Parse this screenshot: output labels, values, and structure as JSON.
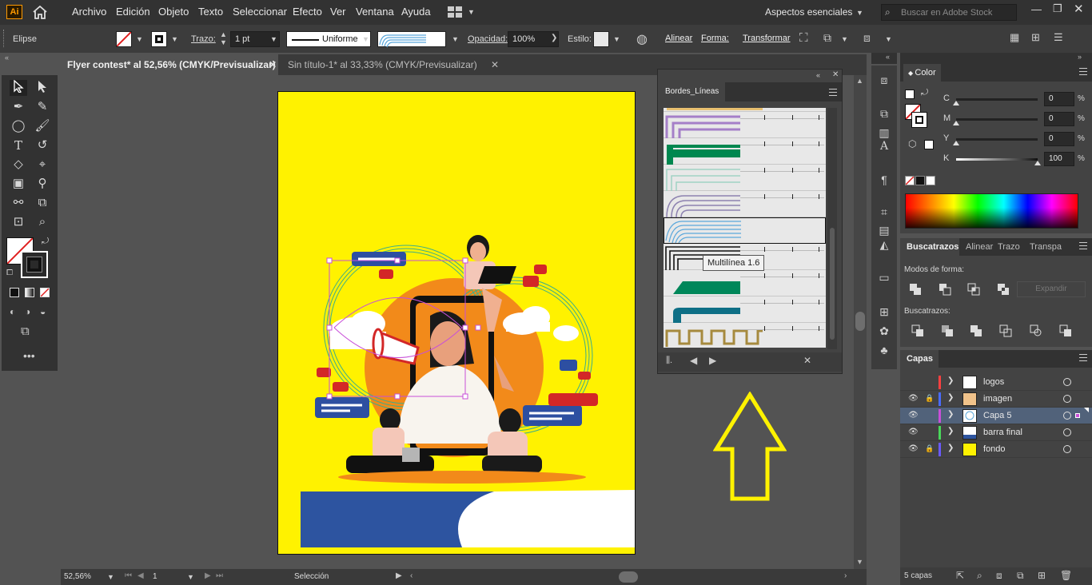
{
  "app": {
    "logo": "Ai",
    "accent": "#ff9a00"
  },
  "menubar": {
    "items": [
      "Archivo",
      "Edición",
      "Objeto",
      "Texto",
      "Seleccionar",
      "Efecto",
      "Ver",
      "Ventana",
      "Ayuda"
    ],
    "workspace": "Aspectos esenciales",
    "search_placeholder": "Buscar en Adobe Stock"
  },
  "controlbar": {
    "selection_type": "Elipse",
    "stroke_label": "Trazo:",
    "stroke_weight": "1 pt",
    "profile": "Uniforme",
    "opacity_label": "Opacidad:",
    "opacity": "100%",
    "style_label": "Estilo:",
    "align": "Alinear",
    "shape": "Forma:",
    "transform": "Transformar"
  },
  "tabs": [
    {
      "label": "Flyer contest* al 52,56% (CMYK/Previsualizar)",
      "active": true
    },
    {
      "label": "Sin título-1* al 33,33% (CMYK/Previsualizar)",
      "active": false
    }
  ],
  "status": {
    "zoom": "52,56%",
    "page": "1",
    "tool": "Selección"
  },
  "brushes_panel": {
    "title": "Bordes_Líneas",
    "tooltip": "Multilínea 1.6",
    "rows": [
      {
        "name": "purple-steps",
        "color": "#a57fc8"
      },
      {
        "name": "green-steps",
        "color": "#00874f"
      },
      {
        "name": "mint-steps",
        "color": "#9fd3c4"
      },
      {
        "name": "lavender-arcs",
        "color": "#8d82b0"
      },
      {
        "name": "blue-multiline",
        "color": "#5ba8dc"
      },
      {
        "name": "black-multiline",
        "color": "#111111"
      },
      {
        "name": "green-ramp",
        "color": "#00875a"
      },
      {
        "name": "teal-ramp",
        "color": "#0e6f86"
      },
      {
        "name": "gold-meander",
        "color": "#a68a3e"
      }
    ]
  },
  "color_panel": {
    "title": "Color",
    "channels": [
      {
        "label": "C",
        "value": "0"
      },
      {
        "label": "M",
        "value": "0"
      },
      {
        "label": "Y",
        "value": "0"
      },
      {
        "label": "K",
        "value": "100"
      }
    ],
    "pct": "%"
  },
  "pathfinder": {
    "tabs": [
      "Buscatrazos",
      "Alinear",
      "Trazo",
      "Transpa"
    ],
    "shape_modes": "Modos de forma:",
    "expand": "Expandir",
    "pathfinders": "Buscatrazos:"
  },
  "layers": {
    "title": "Capas",
    "items": [
      {
        "name": "logos",
        "color": "#ff4040",
        "visible": false,
        "locked": false,
        "selected": false
      },
      {
        "name": "imagen",
        "color": "#4a6cff",
        "visible": true,
        "locked": true,
        "selected": false
      },
      {
        "name": "Capa 5",
        "color": "#c94fd8",
        "visible": true,
        "locked": false,
        "selected": true
      },
      {
        "name": "barra final",
        "color": "#4ad85a",
        "visible": true,
        "locked": false,
        "selected": false
      },
      {
        "name": "fondo",
        "color": "#6a5aff",
        "visible": true,
        "locked": true,
        "selected": false
      }
    ],
    "count": "5 capas"
  }
}
